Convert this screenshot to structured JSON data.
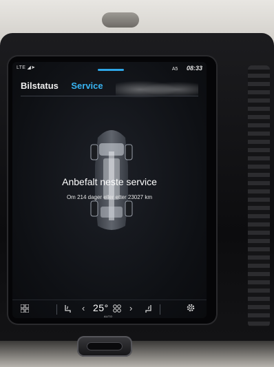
{
  "status_bar": {
    "network": "LTE",
    "gps": "A5",
    "time": "08:33"
  },
  "tabs": [
    {
      "label": "Bilstatus",
      "active": false
    },
    {
      "label": "Service",
      "active": true
    }
  ],
  "service": {
    "title": "Anbefalt neste service",
    "detail": "Om 214 dager eller etter 23027 km"
  },
  "climate_bar": {
    "temperature": "25°",
    "mode": "AUTO",
    "icons": [
      "grid-menu-icon",
      "seat-heat-left-icon",
      "chevron-left-icon",
      "fan-icon",
      "chevron-right-icon",
      "seat-heat-right-icon",
      "gear-icon"
    ]
  },
  "colors": {
    "accent": "#38b4f2",
    "handle": "#2ea7e8",
    "screen_bg": "#0e1014"
  }
}
